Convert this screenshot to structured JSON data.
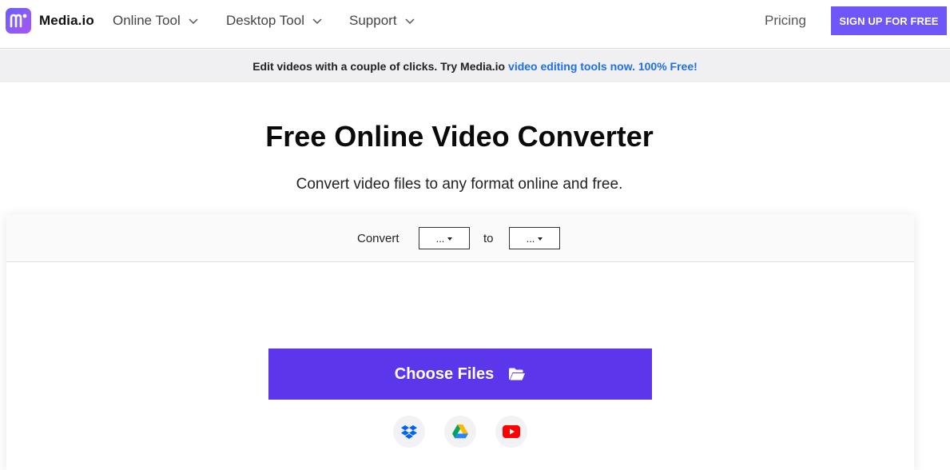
{
  "header": {
    "brand": "Media.io",
    "nav": [
      {
        "label": "Online Tool"
      },
      {
        "label": "Desktop Tool"
      },
      {
        "label": "Support"
      }
    ],
    "pricing": "Pricing",
    "signup": "SIGN UP FOR FREE"
  },
  "banner": {
    "text": "Edit videos with a couple of clicks. Try Media.io",
    "link": "video editing tools now. 100% Free!",
    "link_color": "#1e6fe8"
  },
  "hero": {
    "title": "Free Online Video Converter",
    "subtitle": "Convert video files to any format online and free."
  },
  "converter": {
    "convert_label": "Convert",
    "from_value": "...",
    "to_label": "to",
    "to_value": "...",
    "choose_files": "Choose Files",
    "sources": [
      "dropbox-icon",
      "google-drive-icon",
      "youtube-icon"
    ]
  },
  "colors": {
    "accent": "#6e56f8",
    "choose_button": "#5c36ea",
    "banner_bg": "#f0f0f2"
  }
}
